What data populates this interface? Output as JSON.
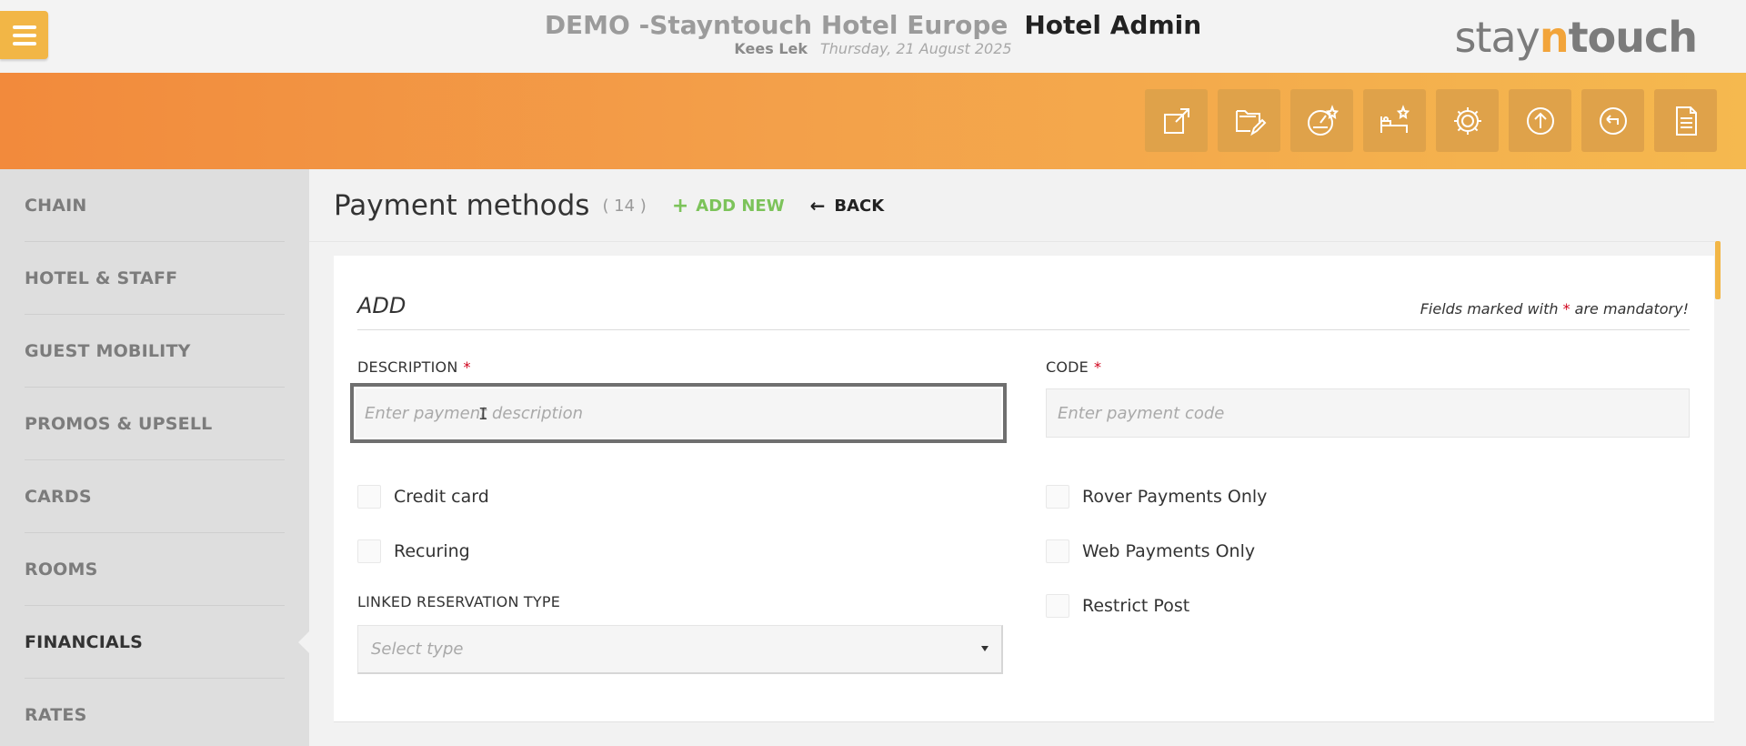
{
  "header": {
    "hotel_name": "DEMO -Stayntouch Hotel Europe",
    "app_name": "Hotel Admin",
    "user": "Kees Lek",
    "date": "Thursday, 21 August 2025",
    "brand_a": "stay",
    "brand_b": "n",
    "brand_c": "touch",
    "brand_color": "#f2a43a",
    "menu_button_color": "#f2b646"
  },
  "toolbar": {
    "icons": [
      "external-link-icon",
      "folder-edit-icon",
      "dashboard-star-icon",
      "bed-star-icon",
      "gear-icon",
      "upload-circle-icon",
      "back-circle-icon",
      "document-icon"
    ]
  },
  "sidebar": {
    "items": [
      {
        "label": "CHAIN"
      },
      {
        "label": "HOTEL & STAFF"
      },
      {
        "label": "GUEST MOBILITY"
      },
      {
        "label": "PROMOS & UPSELL"
      },
      {
        "label": "CARDS"
      },
      {
        "label": "ROOMS"
      },
      {
        "label": "FINANCIALS"
      },
      {
        "label": "RATES"
      }
    ],
    "active": "FINANCIALS"
  },
  "page": {
    "title": "Payment methods",
    "count": "( 14 )",
    "add_new": "ADD NEW",
    "back": "BACK"
  },
  "form": {
    "heading": "ADD",
    "mandatory_prefix": "Fields marked with",
    "mandatory_star": "*",
    "mandatory_suffix": "are mandatory!",
    "description_label": "DESCRIPTION",
    "description_placeholder": "Enter payment description",
    "code_label": "CODE",
    "code_placeholder": "Enter payment code",
    "required_star": "*",
    "checkboxes_left": [
      {
        "label": "Credit card",
        "checked": false
      },
      {
        "label": "Recuring",
        "checked": false
      }
    ],
    "checkboxes_right": [
      {
        "label": "Rover Payments Only",
        "checked": false
      },
      {
        "label": "Web Payments Only",
        "checked": false
      },
      {
        "label": "Restrict Post",
        "checked": false
      }
    ],
    "linked_type_label": "LINKED RESERVATION TYPE",
    "linked_type_value": "Select type"
  },
  "colors": {
    "accent_orange": "#f28a3c",
    "accent_yellow": "#f5b94f",
    "add_new_green": "#7cc35a",
    "required_red": "#d0021b"
  }
}
